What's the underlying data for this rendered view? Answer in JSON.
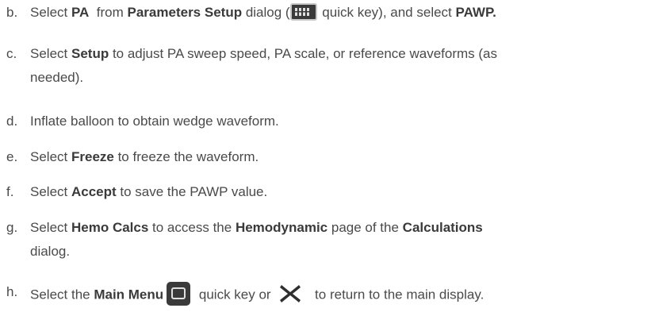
{
  "steps": [
    {
      "marker": "b.",
      "segments": {
        "s1": "Select ",
        "s2": "PA",
        "s3": "  from ",
        "s4": "Parameters Setup",
        "s5": " dialog (",
        "icon": "parameters-setup-icon",
        "s6": " quick key), and select ",
        "s7": "PAWP."
      }
    },
    {
      "marker": "c.",
      "segments": {
        "s1": "Select ",
        "s2": "Setup",
        "s3": " to adjust PA sweep speed, PA scale, or reference waveforms (as",
        "s4": "needed)."
      }
    },
    {
      "marker": "d.",
      "segments": {
        "s1": "Inflate balloon to obtain wedge waveform."
      }
    },
    {
      "marker": "e.",
      "segments": {
        "s1": "Select ",
        "s2": "Freeze",
        "s3": " to freeze the waveform."
      }
    },
    {
      "marker": "f.",
      "segments": {
        "s1": "Select ",
        "s2": "Accept",
        "s3": " to save the PAWP value."
      }
    },
    {
      "marker": "g.",
      "segments": {
        "s1": "Select ",
        "s2": "Hemo Calcs",
        "s3": " to access the ",
        "s4": "Hemodynamic",
        "s5": " page of the ",
        "s6": "Calculations",
        "s7": "dialog."
      }
    },
    {
      "marker": "h.",
      "segments": {
        "s1": "Select the ",
        "s2": "Main Menu",
        "icon1": "main-menu-icon",
        "s3": " quick key or ",
        "icon2": "close-x-icon",
        "s4": " to return to the main display."
      }
    }
  ],
  "colors": {
    "text": "#4a4a4a",
    "icon_dark": "#3a3a3a",
    "icon_light": "#e0e0e0"
  }
}
